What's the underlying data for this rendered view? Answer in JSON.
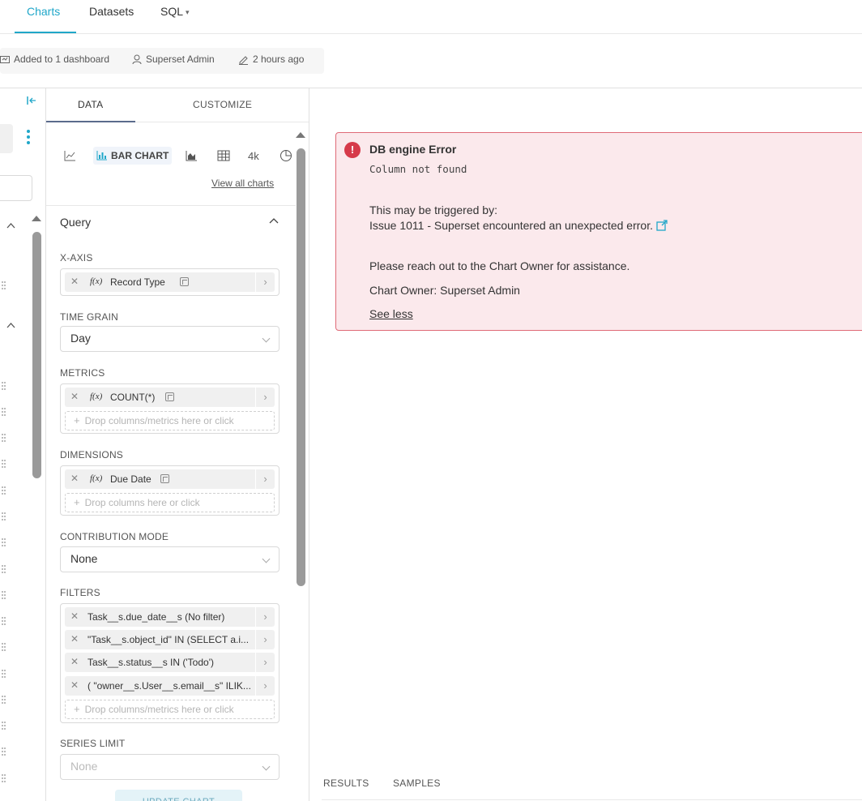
{
  "nav": {
    "items": [
      "Charts",
      "Datasets",
      "SQL"
    ],
    "sql_caret": "▾"
  },
  "meta": {
    "dashboards": "Added to 1 dashboard",
    "owner": "Superset Admin",
    "modified": "2 hours ago"
  },
  "control_panel": {
    "tabs": [
      "DATA",
      "CUSTOMIZE"
    ],
    "viz": {
      "selected_label": "BAR CHART",
      "extra_label": "4k",
      "view_all": "View all charts"
    },
    "query_title": "Query",
    "x_axis": {
      "label": "X-AXIS",
      "value": "Record Type",
      "fx": "f(x)"
    },
    "time_grain": {
      "label": "TIME GRAIN",
      "value": "Day"
    },
    "metrics": {
      "label": "METRICS",
      "value": "COUNT(*)",
      "fx": "f(x)",
      "drop_hint": "Drop columns/metrics here or click"
    },
    "dimensions": {
      "label": "DIMENSIONS",
      "value": "Due Date",
      "fx": "f(x)",
      "drop_hint": "Drop columns here or click"
    },
    "contribution_mode": {
      "label": "CONTRIBUTION MODE",
      "value": "None"
    },
    "filters": {
      "label": "FILTERS",
      "items": [
        "Task__s.due_date__s (No filter)",
        "\"Task__s.object_id\" IN (SELECT a.i...",
        "Task__s.status__s IN ('Todo')",
        "( \"owner__s.User__s.email__s\" ILIK..."
      ],
      "drop_hint": "Drop columns/metrics here or click"
    },
    "series_limit": {
      "label": "SERIES LIMIT",
      "placeholder": "None"
    },
    "update_button": "UPDATE CHART"
  },
  "error": {
    "title": "DB engine Error",
    "code": "Column not found",
    "triggered_by": "This may be triggered by:",
    "issue": "Issue 1011 - Superset encountered an unexpected error.",
    "reach_out": "Please reach out to the Chart Owner for assistance.",
    "owner": "Chart Owner: Superset Admin",
    "see_less": "See less"
  },
  "bottom_tabs": [
    "RESULTS",
    "SAMPLES"
  ],
  "colors": {
    "accent": "#20a7c9",
    "error_bg": "#fbe9ec",
    "error_border": "#df6a77",
    "error_icon": "#d63a4a"
  },
  "icons": [
    "chart-line-icon",
    "bar-chart-icon",
    "area-chart-icon",
    "table-icon",
    "pie-chart-icon",
    "collapse-panel-icon",
    "kebab-menu-icon",
    "chevron-up-icon",
    "close-icon",
    "chevron-right-icon",
    "caret-down-icon",
    "plus-icon",
    "error-icon",
    "external-link-icon",
    "dashboard-icon",
    "user-icon",
    "pencil-icon",
    "drag-handle-icon"
  ]
}
